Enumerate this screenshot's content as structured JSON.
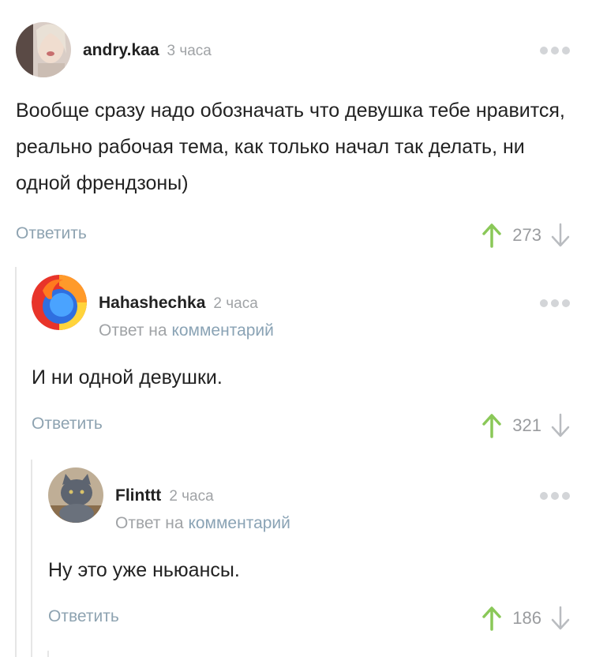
{
  "comments": [
    {
      "author": "andry.kaa",
      "time": "3 часа",
      "text": "Вообще сразу надо обозначать что девушка тебе нравится, реально рабочая тема, как только начал так делать, ни одной френдзоны)",
      "reply_label": "Ответить",
      "rating": "273"
    },
    {
      "author": "Hahashechka",
      "time": "2 часа",
      "reply_prefix": "Ответ на",
      "reply_link": "комментарий",
      "text": "И ни одной девушки.",
      "reply_label": "Ответить",
      "rating": "321"
    },
    {
      "author": "Flinttt",
      "time": "2 часа",
      "reply_prefix": "Ответ на",
      "reply_link": "комментарий",
      "text": "Ну это уже ньюансы.",
      "reply_label": "Ответить",
      "rating": "186"
    }
  ],
  "colors": {
    "upvote": "#8ac858",
    "downvote": "#b9bcc0",
    "link": "#8aa3b5",
    "thread_line": "#e6e6e6"
  },
  "icons": [
    "avatar-photo",
    "more-icon",
    "upvote-arrow-icon",
    "downvote-arrow-icon"
  ]
}
